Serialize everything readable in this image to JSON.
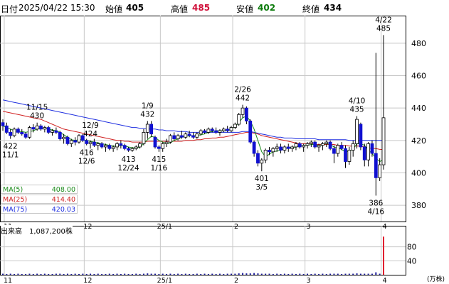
{
  "header": {
    "date_label": "日付",
    "datetime": "2025/04/22 15:30",
    "open_label": "始値",
    "open": "405",
    "high_label": "高値",
    "high": "485",
    "low_label": "安値",
    "low": "402",
    "close_label": "終値",
    "close": "434"
  },
  "colors": {
    "up": "#0a9a0a",
    "down": "#1010d0",
    "ma5": "#1a8a1a",
    "ma25": "#d02020",
    "ma75": "#2030e0",
    "high": "#d0103a",
    "low": "#0a7a0a",
    "volume": "#2020a0",
    "volume_last": "#e02030",
    "grid": "#c8c8c8"
  },
  "ma_legend": [
    {
      "name": "MA(5)",
      "value": "408.00",
      "color": "#1a8a1a"
    },
    {
      "name": "MA(25)",
      "value": "414.40",
      "color": "#d02020"
    },
    {
      "name": "MA(75)",
      "value": "420.03",
      "color": "#2030e0"
    }
  ],
  "volume_panel": {
    "label": "出来高　1,087,200株",
    "unit": "(万株)",
    "y_ticks": [
      "80",
      "40"
    ]
  },
  "chart_data": {
    "type": "candlestick",
    "title": "",
    "ylim": [
      370,
      497
    ],
    "y_ticks": [
      380,
      400,
      420,
      440,
      460,
      480
    ],
    "x_ticks": [
      {
        "label": "11",
        "index": 0
      },
      {
        "label": "12",
        "index": 21
      },
      {
        "label": "25/1",
        "index": 41
      },
      {
        "label": "2",
        "index": 60
      },
      {
        "label": "3",
        "index": 79
      },
      {
        "label": "4",
        "index": 99
      }
    ],
    "candles": [
      [
        431,
        433,
        426,
        429
      ],
      [
        429,
        431,
        424,
        425
      ],
      [
        425,
        427,
        421,
        423
      ],
      [
        423,
        428,
        422,
        427
      ],
      [
        427,
        428,
        424,
        425
      ],
      [
        425,
        427,
        423,
        424
      ],
      [
        424,
        425,
        421,
        422
      ],
      [
        422,
        429,
        421,
        428
      ],
      [
        428,
        430,
        425,
        427
      ],
      [
        427,
        431,
        426,
        429
      ],
      [
        429,
        430,
        426,
        427
      ],
      [
        427,
        429,
        425,
        428
      ],
      [
        428,
        429,
        424,
        425
      ],
      [
        425,
        427,
        423,
        426
      ],
      [
        426,
        428,
        424,
        425
      ],
      [
        425,
        426,
        420,
        421
      ],
      [
        421,
        424,
        418,
        422
      ],
      [
        422,
        423,
        417,
        418
      ],
      [
        418,
        421,
        416,
        420
      ],
      [
        420,
        422,
        417,
        419
      ],
      [
        419,
        424,
        418,
        423
      ],
      [
        423,
        424,
        419,
        420
      ],
      [
        420,
        421,
        417,
        418
      ],
      [
        418,
        420,
        415,
        419
      ],
      [
        419,
        421,
        416,
        417
      ],
      [
        417,
        419,
        414,
        418
      ],
      [
        418,
        419,
        415,
        416
      ],
      [
        416,
        418,
        413,
        417
      ],
      [
        417,
        418,
        414,
        415
      ],
      [
        415,
        417,
        413,
        416
      ],
      [
        416,
        419,
        414,
        418
      ],
      [
        418,
        420,
        415,
        417
      ],
      [
        417,
        418,
        414,
        415
      ],
      [
        415,
        416,
        413,
        414
      ],
      [
        414,
        416,
        413,
        415
      ],
      [
        415,
        417,
        414,
        416
      ],
      [
        416,
        419,
        415,
        418
      ],
      [
        418,
        427,
        417,
        425
      ],
      [
        425,
        432,
        421,
        430
      ],
      [
        430,
        432,
        422,
        424
      ],
      [
        422,
        423,
        415,
        416
      ],
      [
        416,
        417,
        413,
        415
      ],
      [
        415,
        419,
        413,
        418
      ],
      [
        418,
        421,
        416,
        419
      ],
      [
        419,
        424,
        418,
        423
      ],
      [
        423,
        425,
        420,
        421
      ],
      [
        421,
        424,
        420,
        423
      ],
      [
        423,
        426,
        421,
        422
      ],
      [
        422,
        425,
        421,
        424
      ],
      [
        424,
        426,
        422,
        423
      ],
      [
        423,
        425,
        421,
        422
      ],
      [
        422,
        425,
        421,
        424
      ],
      [
        424,
        427,
        423,
        426
      ],
      [
        426,
        427,
        424,
        425
      ],
      [
        425,
        428,
        424,
        427
      ],
      [
        427,
        428,
        425,
        426
      ],
      [
        426,
        428,
        424,
        425
      ],
      [
        425,
        427,
        423,
        426
      ],
      [
        426,
        428,
        425,
        427
      ],
      [
        427,
        429,
        425,
        426
      ],
      [
        426,
        429,
        425,
        428
      ],
      [
        428,
        431,
        427,
        430
      ],
      [
        430,
        437,
        429,
        436
      ],
      [
        436,
        442,
        434,
        440
      ],
      [
        440,
        441,
        430,
        432
      ],
      [
        432,
        433,
        418,
        419
      ],
      [
        419,
        420,
        410,
        412
      ],
      [
        412,
        414,
        404,
        406
      ],
      [
        406,
        409,
        401,
        408
      ],
      [
        408,
        415,
        406,
        414
      ],
      [
        414,
        416,
        411,
        413
      ],
      [
        413,
        416,
        410,
        415
      ],
      [
        415,
        418,
        413,
        416
      ],
      [
        416,
        418,
        412,
        414
      ],
      [
        414,
        417,
        412,
        416
      ],
      [
        416,
        418,
        413,
        415
      ],
      [
        415,
        417,
        413,
        416
      ],
      [
        416,
        419,
        414,
        418
      ],
      [
        418,
        419,
        415,
        416
      ],
      [
        416,
        418,
        413,
        417
      ],
      [
        417,
        419,
        415,
        418
      ],
      [
        418,
        420,
        416,
        419
      ],
      [
        419,
        420,
        415,
        416
      ],
      [
        416,
        418,
        413,
        417
      ],
      [
        417,
        419,
        414,
        418
      ],
      [
        418,
        420,
        416,
        419
      ],
      [
        419,
        420,
        414,
        415
      ],
      [
        415,
        417,
        406,
        412
      ],
      [
        412,
        418,
        410,
        417
      ],
      [
        417,
        419,
        414,
        415
      ],
      [
        415,
        417,
        403,
        407
      ],
      [
        407,
        416,
        405,
        414
      ],
      [
        414,
        420,
        410,
        418
      ],
      [
        418,
        435,
        415,
        433
      ],
      [
        430,
        431,
        414,
        416
      ],
      [
        416,
        418,
        404,
        408
      ],
      [
        408,
        419,
        404,
        418
      ],
      [
        418,
        420,
        410,
        412
      ],
      [
        412,
        474,
        386,
        397
      ],
      [
        397,
        409,
        395,
        405
      ],
      [
        405,
        485,
        402,
        434
      ]
    ],
    "ma5": [
      429,
      428,
      427,
      426,
      425.5,
      425.5,
      425,
      425.5,
      426,
      427,
      427.5,
      427.5,
      427,
      426.5,
      426,
      425,
      423.5,
      422,
      420.5,
      420,
      420.5,
      420.5,
      420,
      419.5,
      419,
      418.5,
      418,
      417.5,
      417,
      416.5,
      416.5,
      417,
      416.5,
      416,
      415.5,
      415.5,
      416,
      418,
      420.5,
      422.5,
      422,
      420,
      419,
      418,
      418.5,
      420,
      421,
      422,
      422.5,
      423,
      423,
      423,
      423.5,
      424,
      425,
      425.5,
      426,
      426,
      426,
      426,
      427,
      428.5,
      431,
      434,
      435,
      432,
      427,
      420,
      413,
      410,
      411.5,
      413,
      413.5,
      414,
      415,
      415.5,
      415.5,
      416,
      416.5,
      417,
      417,
      417.5,
      417.5,
      417,
      417.5,
      418,
      417.5,
      416,
      415.5,
      414.5,
      413,
      413.5,
      414.5,
      418,
      418,
      417,
      414,
      412,
      409,
      407,
      408
    ],
    "ma25": [
      438,
      437.5,
      437,
      436.5,
      436,
      435.5,
      435,
      434.5,
      434,
      433.5,
      433,
      432,
      431,
      430,
      429,
      428,
      427,
      426.5,
      426,
      425.5,
      425,
      424.5,
      424,
      423.5,
      423,
      422.5,
      422,
      421.5,
      421,
      420.5,
      420,
      420,
      419.5,
      419.5,
      419,
      419,
      419,
      419,
      419.5,
      419.5,
      419.5,
      419.5,
      419.5,
      419.5,
      419.5,
      419.5,
      419.5,
      419.5,
      420,
      420,
      420,
      420.5,
      420.5,
      421,
      421,
      421.5,
      421.5,
      422,
      422,
      422.5,
      423,
      423.5,
      424,
      424.5,
      425,
      425,
      424.5,
      424,
      423,
      422.5,
      422,
      421.5,
      421,
      420.5,
      420,
      419.5,
      419,
      418.5,
      418,
      418,
      418,
      418,
      417.5,
      417.5,
      417.5,
      417.5,
      417.5,
      417.5,
      417,
      417,
      417,
      416.5,
      416.5,
      416.5,
      416.5,
      416,
      415.5,
      415,
      415,
      414.5,
      414.4
    ],
    "ma75": [
      445,
      444.5,
      444,
      443.5,
      443,
      442.5,
      442,
      441.5,
      441,
      440.5,
      440,
      439.5,
      439,
      438.5,
      438,
      437.5,
      437,
      436.5,
      436,
      435.5,
      435,
      434.5,
      434,
      433.5,
      433,
      432.5,
      432,
      431.5,
      431,
      430.5,
      430,
      429.5,
      429,
      428.5,
      428,
      428,
      427.5,
      427.5,
      427,
      427,
      427,
      426.5,
      426.5,
      426,
      426,
      426,
      425.5,
      425.5,
      425.5,
      425,
      425,
      425,
      425,
      425,
      425,
      425,
      425,
      425,
      425,
      425,
      425,
      425,
      425,
      425.5,
      425.5,
      425.5,
      425,
      424.5,
      424,
      423.5,
      423,
      422.5,
      422,
      422,
      421.5,
      421.5,
      421.5,
      421,
      421,
      421,
      421,
      421,
      421,
      420.5,
      420.5,
      420.5,
      420.5,
      420.5,
      420.5,
      420.5,
      420.5,
      420,
      420,
      420,
      420,
      420,
      420,
      420,
      420,
      420,
      420.03
    ],
    "volume": [
      3,
      2,
      3,
      2,
      3,
      2,
      2,
      3,
      2,
      3,
      2,
      3,
      2,
      2,
      3,
      3,
      2,
      3,
      2,
      3,
      2,
      3,
      2,
      3,
      2,
      3,
      2,
      2,
      3,
      2,
      3,
      2,
      3,
      2,
      2,
      3,
      2,
      3,
      4,
      3,
      3,
      2,
      3,
      2,
      3,
      2,
      3,
      2,
      3,
      2,
      2,
      3,
      2,
      3,
      2,
      3,
      2,
      3,
      2,
      3,
      3,
      3,
      4,
      5,
      4,
      4,
      5,
      4,
      3,
      3,
      3,
      2,
      3,
      2,
      3,
      2,
      3,
      2,
      3,
      2,
      3,
      2,
      3,
      2,
      3,
      2,
      3,
      3,
      3,
      2,
      3,
      3,
      3,
      4,
      3,
      3,
      3,
      3,
      7,
      3,
      109
    ],
    "volume_ylim": [
      0,
      140
    ],
    "volume_ticks": [
      80,
      40
    ],
    "annotations": [
      {
        "date": "11/1",
        "value": "422",
        "index": 2,
        "pos": "below"
      },
      {
        "date": "11/15",
        "value": "430",
        "index": 9,
        "pos": "above"
      },
      {
        "date": "12/9",
        "value": "424",
        "index": 23,
        "pos": "above"
      },
      {
        "date": "12/6",
        "value": "416",
        "index": 22,
        "pos": "below"
      },
      {
        "date": "12/24",
        "value": "413",
        "index": 33,
        "pos": "below"
      },
      {
        "date": "1/9",
        "value": "432",
        "index": 38,
        "pos": "above"
      },
      {
        "date": "1/16",
        "value": "415",
        "index": 41,
        "pos": "below"
      },
      {
        "date": "2/26",
        "value": "442",
        "index": 63,
        "pos": "above"
      },
      {
        "date": "3/5",
        "value": "401",
        "index": 68,
        "pos": "below"
      },
      {
        "date": "4/10",
        "value": "435",
        "index": 93,
        "pos": "above"
      },
      {
        "date": "4/16",
        "value": "386",
        "index": 98,
        "pos": "below"
      },
      {
        "date": "4/22",
        "value": "485",
        "index": 100,
        "pos": "above"
      }
    ]
  }
}
